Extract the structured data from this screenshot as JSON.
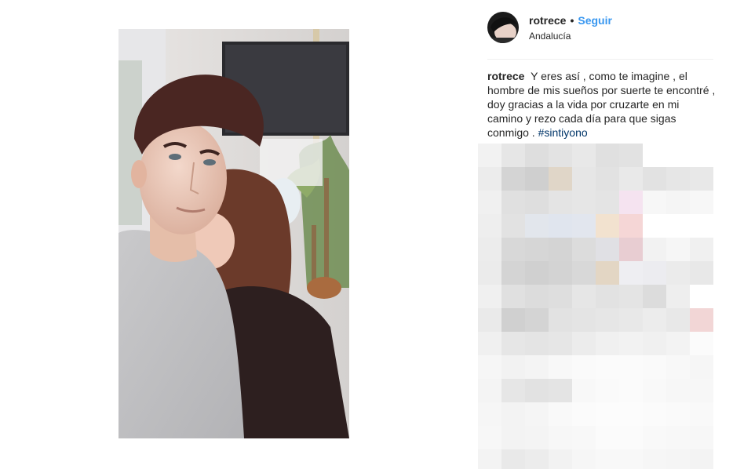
{
  "post": {
    "photo_icon": "selfie-photo",
    "username": "rotrece",
    "separator": "•",
    "follow_label": "Seguir",
    "location": "Andalucía",
    "caption": {
      "username": "rotrece",
      "text": "Y eres así , como te imagine , el hombre de mis sueños por suerte te encontré , doy gracias a la vida por cruzarte en mi camino y rezo cada día para que sigas conmigo .",
      "hashtag": "#sintiyono"
    }
  },
  "colors": {
    "follow": "#3897f0",
    "hashtag": "#003569",
    "text": "#262626",
    "divider": "#efefef"
  },
  "mosaic": {
    "icon": "pixelated-comments",
    "rows": [
      [
        "#f2f2f2",
        "#e6e6e6",
        "#dedede",
        "#e3e3e3",
        "#e8e8e8",
        "#e0e0e0",
        "#e2e2e2",
        "#ffffff",
        "#ffffff",
        "#ffffff",
        "#ffffff"
      ],
      [
        "#ececec",
        "#d4d4d4",
        "#cfcfcf",
        "#e0d6c8",
        "#e6e6e6",
        "#e2e2e2",
        "#e9e9e9",
        "#e2e2e2",
        "#e6e6e6",
        "#e8e8e8",
        "#ffffff"
      ],
      [
        "#f0f0f0",
        "#e0e0e0",
        "#dedede",
        "#e4e4e4",
        "#e6e6e6",
        "#e4e4e4",
        "#f5e3f0",
        "#f7f7f7",
        "#f5f5f5",
        "#f7f7f7",
        "#ffffff"
      ],
      [
        "#eeeeee",
        "#e2e2e2",
        "#e2e6ec",
        "#e0e5ee",
        "#e2e6ee",
        "#f2e2cf",
        "#f5d6d6",
        "#ffffff",
        "#ffffff",
        "#ffffff",
        "#ffffff"
      ],
      [
        "#ececec",
        "#d8d8d8",
        "#d6d6d6",
        "#d4d4d4",
        "#dcdcdc",
        "#e0e0e4",
        "#e8cdd2",
        "#f2f2f2",
        "#f6f6f6",
        "#f0f0f0",
        "#ffffff"
      ],
      [
        "#ebebeb",
        "#d4d4d4",
        "#d0d0d0",
        "#d3d3d3",
        "#d8d8d8",
        "#e3d6c4",
        "#eeeef2",
        "#ececf0",
        "#ebebeb",
        "#e8e8e8",
        "#ffffff"
      ],
      [
        "#f0f0f0",
        "#e0e0e0",
        "#dcdcdc",
        "#dedede",
        "#e6e6e6",
        "#e2e2e2",
        "#e4e4e4",
        "#dcdcdc",
        "#eeeeee",
        "#ffffff",
        "#ffffff"
      ],
      [
        "#eaeaea",
        "#d0d0d0",
        "#d4d4d4",
        "#e2e2e2",
        "#e4e4e4",
        "#e6e6e6",
        "#e8e8e8",
        "#ececec",
        "#e8e8e8",
        "#f2d6d6",
        "#ffffff"
      ],
      [
        "#f0f0f0",
        "#e6e6e6",
        "#e4e4e4",
        "#e6e6e6",
        "#ececec",
        "#f0f0f0",
        "#f2f2f2",
        "#f0f0f0",
        "#f3f3f3",
        "#fbfbfb",
        "#ffffff"
      ],
      [
        "#f6f6f6",
        "#f2f2f2",
        "#f4f4f4",
        "#f8f8f8",
        "#fafafa",
        "#fbfbfb",
        "#fbfbfb",
        "#fafafa",
        "#f8f8f8",
        "#f6f6f6",
        "#ffffff"
      ],
      [
        "#f4f4f4",
        "#e6e6e6",
        "#e2e2e2",
        "#e4e4e4",
        "#f8f8f8",
        "#fafafa",
        "#fbfbfb",
        "#f9f9f9",
        "#f7f7f7",
        "#f7f7f7",
        "#ffffff"
      ],
      [
        "#f6f6f6",
        "#f3f3f3",
        "#f5f5f5",
        "#f9f9f9",
        "#fbfbfb",
        "#fcfcfc",
        "#fcfcfc",
        "#fbfbfb",
        "#fafafa",
        "#f9f9f9",
        "#ffffff"
      ],
      [
        "#f7f7f7",
        "#f3f3f3",
        "#f4f4f4",
        "#f7f7f7",
        "#f8f8f8",
        "#fbfbfb",
        "#fbfbfb",
        "#f9f9f9",
        "#f8f8f8",
        "#f7f7f7",
        "#ffffff"
      ],
      [
        "#f3f3f3",
        "#e9e9e9",
        "#ececec",
        "#f2f2f2",
        "#f6f6f6",
        "#f8f8f8",
        "#f8f8f8",
        "#f6f6f6",
        "#f5f5f5",
        "#f3f3f3",
        "#ffffff"
      ]
    ]
  }
}
